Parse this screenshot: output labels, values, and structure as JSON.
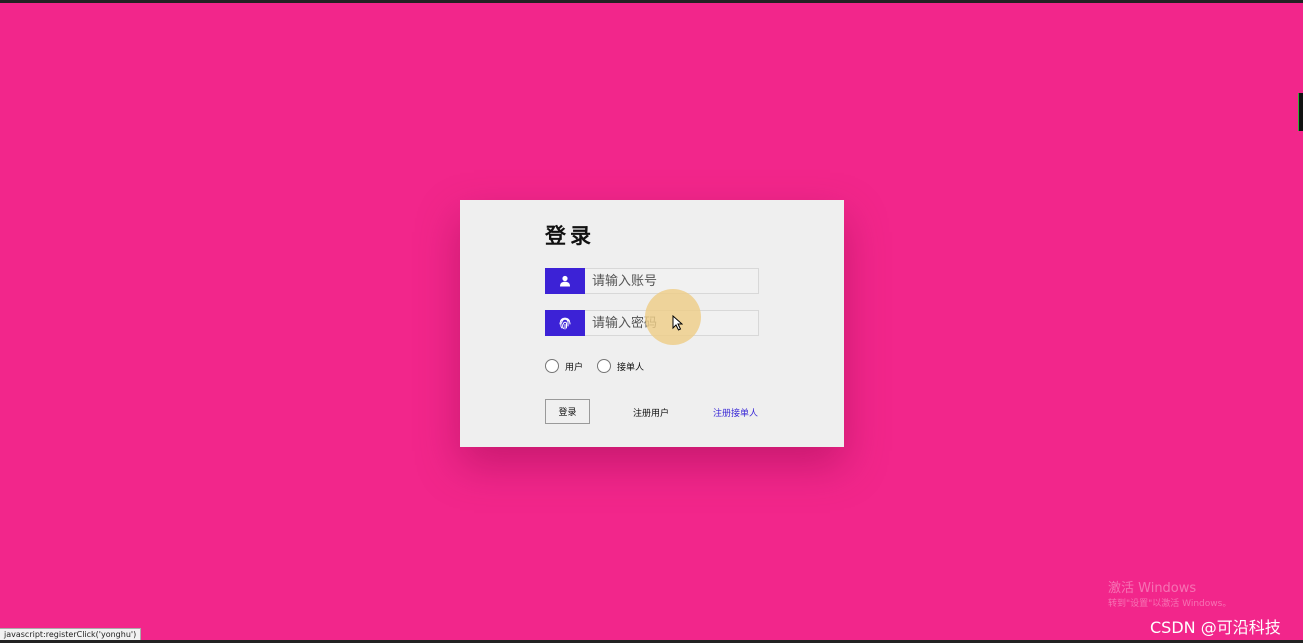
{
  "login": {
    "title": "登录",
    "username_placeholder": "请输入账号",
    "password_placeholder": "请输入密码",
    "roles": [
      "用户",
      "接单人"
    ],
    "login_button": "登录",
    "register_user_link": "注册用户",
    "register_taker_link": "注册接单人"
  },
  "colors": {
    "background": "#f2268b",
    "accent": "#3c22d6",
    "card": "#efefef"
  },
  "icons": {
    "username": "user-icon",
    "password": "fingerprint-icon"
  },
  "status_bar": {
    "text": "javascript:registerClick('yonghu')"
  },
  "watermark": {
    "title": "激活 Windows",
    "subtitle": "转到\"设置\"以激活 Windows。",
    "credit": "CSDN @可沿科技"
  }
}
